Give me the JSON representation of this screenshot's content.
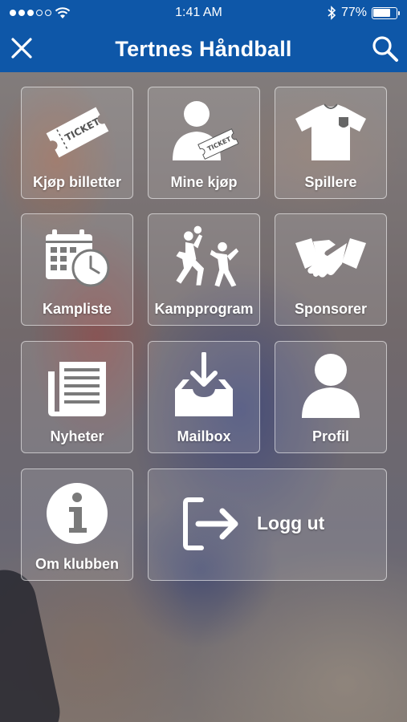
{
  "status_bar": {
    "time": "1:41 AM",
    "battery": "77%",
    "battery_level": 0.77
  },
  "nav": {
    "title": "Tertnes Håndball",
    "close_icon": "close-icon",
    "search_icon": "search-icon"
  },
  "menu": {
    "items": [
      {
        "label": "Kjøp billetter",
        "icon": "ticket-icon"
      },
      {
        "label": "Mine kjøp",
        "icon": "person-ticket-icon"
      },
      {
        "label": "Spillere",
        "icon": "jersey-icon"
      },
      {
        "label": "Kampliste",
        "icon": "calendar-clock-icon"
      },
      {
        "label": "Kampprogram",
        "icon": "handball-players-icon"
      },
      {
        "label": "Sponsorer",
        "icon": "handshake-icon"
      },
      {
        "label": "Nyheter",
        "icon": "newspaper-icon"
      },
      {
        "label": "Mailbox",
        "icon": "inbox-download-icon"
      },
      {
        "label": "Profil",
        "icon": "person-icon"
      },
      {
        "label": "Om klubben",
        "icon": "info-icon"
      },
      {
        "label": "Logg ut",
        "icon": "logout-icon"
      }
    ]
  },
  "colors": {
    "brand_blue": "#0e57a8",
    "tile_border": "#ffffff"
  }
}
